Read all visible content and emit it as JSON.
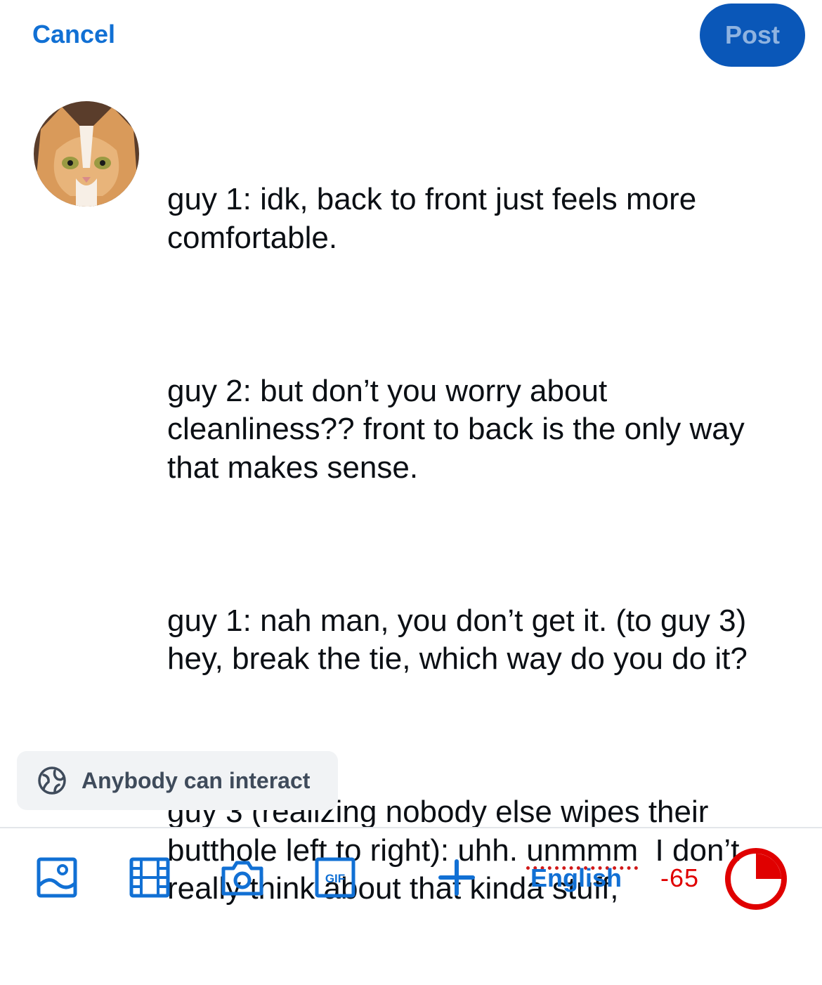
{
  "header": {
    "cancel_label": "Cancel",
    "post_label": "Post"
  },
  "composer": {
    "paragraphs": [
      "guy 1: idk, back to front just feels more comfortable.",
      "guy 2: but don’t you worry about cleanliness?? front to back is the only way that makes sense.",
      "guy 1: nah man, you don’t get it. (to guy 3) hey, break the tie, which way do you do it?"
    ],
    "last_paragraph": {
      "before": "guy 3 (realizing nobody else wipes their butthole left to right): uhh. ",
      "misspelled": "unmmm",
      "after": "  I don’t really think about that kinda stuff,"
    }
  },
  "interaction": {
    "label": "Anybody can interact",
    "icon": "globe-icon"
  },
  "toolbar": {
    "icons": [
      "image-icon",
      "video-icon",
      "camera-icon",
      "gif-icon",
      "plus-icon"
    ],
    "gif_text": "GIF",
    "language": "English",
    "char_remaining": "-65",
    "char_progress": 1.0
  },
  "colors": {
    "accent": "#1170d4",
    "post_bg": "#0a57b8",
    "over_limit": "#e00000"
  }
}
